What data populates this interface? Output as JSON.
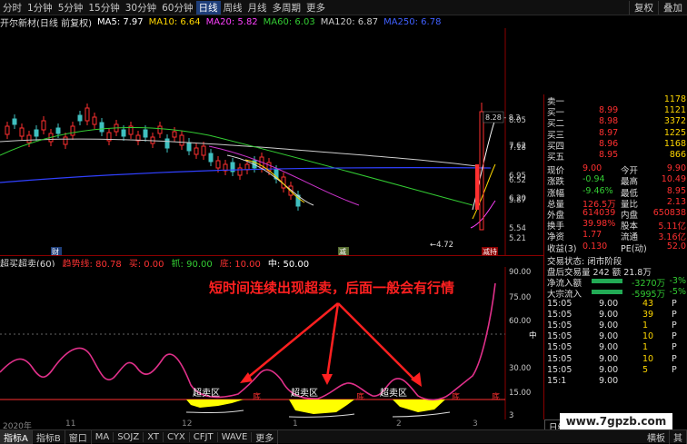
{
  "toolbar": {
    "timeframes": [
      "分时",
      "1分钟",
      "5分钟",
      "15分钟",
      "30分钟",
      "60分钟",
      "日线",
      "周线",
      "月线",
      "多周期",
      "更多"
    ],
    "active": "日线",
    "buttons": [
      "复权",
      "叠加"
    ]
  },
  "legend": {
    "title": "开尔新材(日线 前复权)",
    "items": [
      {
        "label": "MA5: 7.97",
        "color": "#ffffff"
      },
      {
        "label": "MA10: 6.64",
        "color": "#ffd700"
      },
      {
        "label": "MA20: 5.82",
        "color": "#ff40ff"
      },
      {
        "label": "MA60: 6.03",
        "color": "#33cc33"
      },
      {
        "label": "MA120: 6.87",
        "color": "#cccccc"
      },
      {
        "label": "MA250: 6.78",
        "color": "#4060ff"
      }
    ]
  },
  "price_axis": [
    "8.05",
    "7.62",
    "7.18",
    "6.95",
    "6.52",
    "6.20",
    "5.87",
    "5.54",
    "5.21"
  ],
  "annotations": {
    "hi_box": "8.28 - 8.3",
    "low_label": "←4.72",
    "marker_left": "财",
    "marker_mid": "减",
    "marker_right": "减持"
  },
  "indicator": {
    "name": "超买超卖(60)",
    "items": [
      {
        "label": "趋势线: 80.78",
        "color": "#ff3333"
      },
      {
        "label": "买: 0.00",
        "color": "#ff3333"
      },
      {
        "label": "抓: 90.00",
        "color": "#33cc33"
      },
      {
        "label": "底: 10.00",
        "color": "#ff3333"
      },
      {
        "label": "中: 50.00",
        "color": "#ffffff"
      }
    ],
    "axis": [
      "90.00",
      "75.00",
      "60.00",
      "中",
      "30.00",
      "15.00",
      "3"
    ],
    "headline": "短时间连续出现超卖，后面一般会有行情",
    "zone_label": "超卖区",
    "di": "底"
  },
  "dates": [
    "2020年",
    "11",
    "12",
    "1",
    "2",
    "3"
  ],
  "sidebar": {
    "quotes": [
      {
        "name": "卖一",
        "price": "",
        "vol": "1178"
      },
      {
        "name": "买一",
        "price": "8.99",
        "vol": "1121"
      },
      {
        "name": "买二",
        "price": "8.98",
        "vol": "3372"
      },
      {
        "name": "买三",
        "price": "8.97",
        "vol": "1225"
      },
      {
        "name": "买四",
        "price": "8.96",
        "vol": "1168"
      },
      {
        "name": "买五",
        "price": "8.95",
        "vol": "866"
      }
    ],
    "stats": [
      {
        "k1": "现价",
        "v1": "9.00",
        "k2": "今开",
        "v2": "9.90"
      },
      {
        "k1": "涨跌",
        "v1": "-0.94",
        "k2": "最高",
        "v2": "10.49"
      },
      {
        "k1": "涨幅",
        "v1": "-9.46%",
        "k2": "最低",
        "v2": "8.95"
      },
      {
        "k1": "总量",
        "v1": "126.5万",
        "k2": "量比",
        "v2": "2.13"
      },
      {
        "k1": "外盘",
        "v1": "614039",
        "k2": "内盘",
        "v2": "650838"
      },
      {
        "k1": "换手",
        "v1": "39.98%",
        "k2": "股本",
        "v2": "5.11亿"
      },
      {
        "k1": "净资",
        "v1": "1.77",
        "k2": "流通",
        "v2": "3.16亿"
      },
      {
        "k1": "收益(3)",
        "v1": "0.130",
        "k2": "PE(动)",
        "v2": "52.0"
      }
    ],
    "status": "交易状态: 闭市阶段",
    "after": "盘后交易量 242 额 21.8万",
    "flows": [
      {
        "name": "净流入额",
        "val": "-3270万",
        "pct": "-3%"
      },
      {
        "name": "大宗流入",
        "val": "-5995万",
        "pct": "-5%"
      }
    ],
    "ticks": [
      {
        "t": "15:05",
        "p": "9.00",
        "v": "43",
        "s": "P"
      },
      {
        "t": "15:05",
        "p": "9.00",
        "v": "39",
        "s": "P"
      },
      {
        "t": "15:05",
        "p": "9.00",
        "v": "1",
        "s": "P"
      },
      {
        "t": "15:05",
        "p": "9.00",
        "v": "10",
        "s": "P"
      },
      {
        "t": "15:05",
        "p": "9.00",
        "v": "1",
        "s": "P"
      },
      {
        "t": "15:05",
        "p": "9.00",
        "v": "10",
        "s": "P"
      },
      {
        "t": "15:05",
        "p": "9.00",
        "v": "5",
        "s": "P"
      },
      {
        "t": "15:1",
        "p": "9.00",
        "v": "",
        "s": ""
      }
    ],
    "tab": "日线"
  },
  "bottom_tabs": [
    "指标A",
    "指标B",
    "窗口",
    "MA",
    "SOJZ",
    "XT",
    "CYX",
    "CFJT",
    "WAVE",
    "更多"
  ],
  "bottom_right": [
    "横板",
    "其"
  ],
  "watermark": "www.7gpzb.com"
}
